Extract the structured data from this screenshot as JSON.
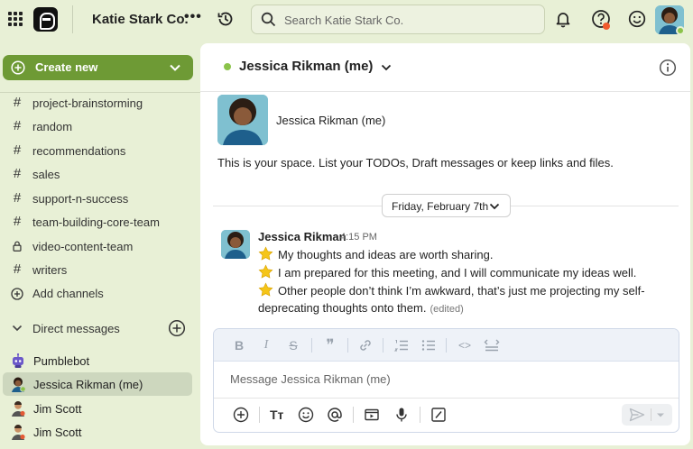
{
  "topbar": {
    "workspace_name": "Katie Stark Co.",
    "more_label": "•••",
    "search_placeholder": "Search Katie Stark Co."
  },
  "sidebar": {
    "create_label": "Create new",
    "channels": [
      {
        "icon": "#",
        "name": "project-brainstorming"
      },
      {
        "icon": "#",
        "name": "random"
      },
      {
        "icon": "#",
        "name": "recommendations"
      },
      {
        "icon": "#",
        "name": "sales"
      },
      {
        "icon": "#",
        "name": "support-n-success"
      },
      {
        "icon": "#",
        "name": "team-building-core-team"
      },
      {
        "icon": "lock",
        "name": "video-content-team"
      },
      {
        "icon": "#",
        "name": "writers"
      }
    ],
    "add_channels_label": "Add channels",
    "dm_header": "Direct messages",
    "dms": [
      {
        "name": "Pumblebot",
        "active": false
      },
      {
        "name": "Jessica Rikman (me)",
        "active": true
      },
      {
        "name": "Jim Scott",
        "active": false
      },
      {
        "name": "Jim Scott",
        "active": false
      }
    ]
  },
  "channel": {
    "title": "Jessica Rikman (me)",
    "intro_name": "Jessica Rikman (me)",
    "intro_text": "This is your space. List your TODOs, Draft messages or keep links and files.",
    "date_label": "Friday, February 7th"
  },
  "message": {
    "author": "Jessica Rikman",
    "time": "4:15 PM",
    "line1": "My thoughts and ideas are worth sharing.",
    "line2": "I am prepared for this meeting, and I will communicate my ideas well.",
    "line3": "Other people don’t think I’m awkward, that’s just me projecting my self-",
    "line4": "deprecating thoughts onto them.",
    "edited_label": "(edited)"
  },
  "composer": {
    "placeholder": "Message Jessica Rikman (me)",
    "format_buttons": {
      "bold": "B",
      "italic": "I",
      "strike": "S",
      "quote": "❞",
      "code": "<>",
      "text_size": "Tт"
    }
  },
  "colors": {
    "accent": "#6e9a35",
    "background": "#e8f0d6",
    "online": "#8bc34a",
    "alert": "#f25a2c"
  }
}
